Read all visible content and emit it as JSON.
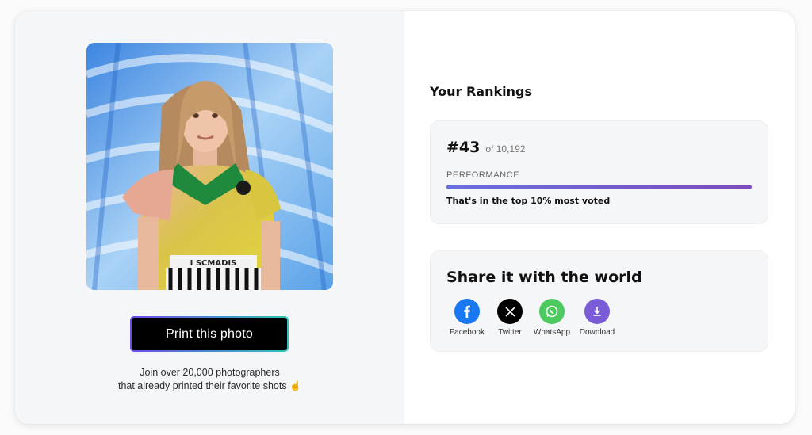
{
  "photo": {
    "print_button_label": "Print this photo",
    "join_line1": "Join over 20,000 photographers",
    "join_line2": "that already printed their favorite shots",
    "join_emoji": "☝"
  },
  "rankings": {
    "title": "Your Rankings",
    "rank": "#43",
    "of_total": "of 10,192",
    "performance_label": "PERFORMANCE",
    "performance_fraction": 1.0,
    "performance_text": "That's in the top 10% most voted",
    "bar_colors": [
      "#6b6ee0",
      "#7a4dbf"
    ]
  },
  "share": {
    "title": "Share it with the world",
    "items": [
      {
        "label": "Facebook",
        "icon": "facebook-icon",
        "color": "#1877f2"
      },
      {
        "label": "Twitter",
        "icon": "x-icon",
        "color": "#000000"
      },
      {
        "label": "WhatsApp",
        "icon": "whatsapp-icon",
        "color": "#4cc95f"
      },
      {
        "label": "Download",
        "icon": "download-icon",
        "color": "#7a5cd6"
      }
    ]
  }
}
